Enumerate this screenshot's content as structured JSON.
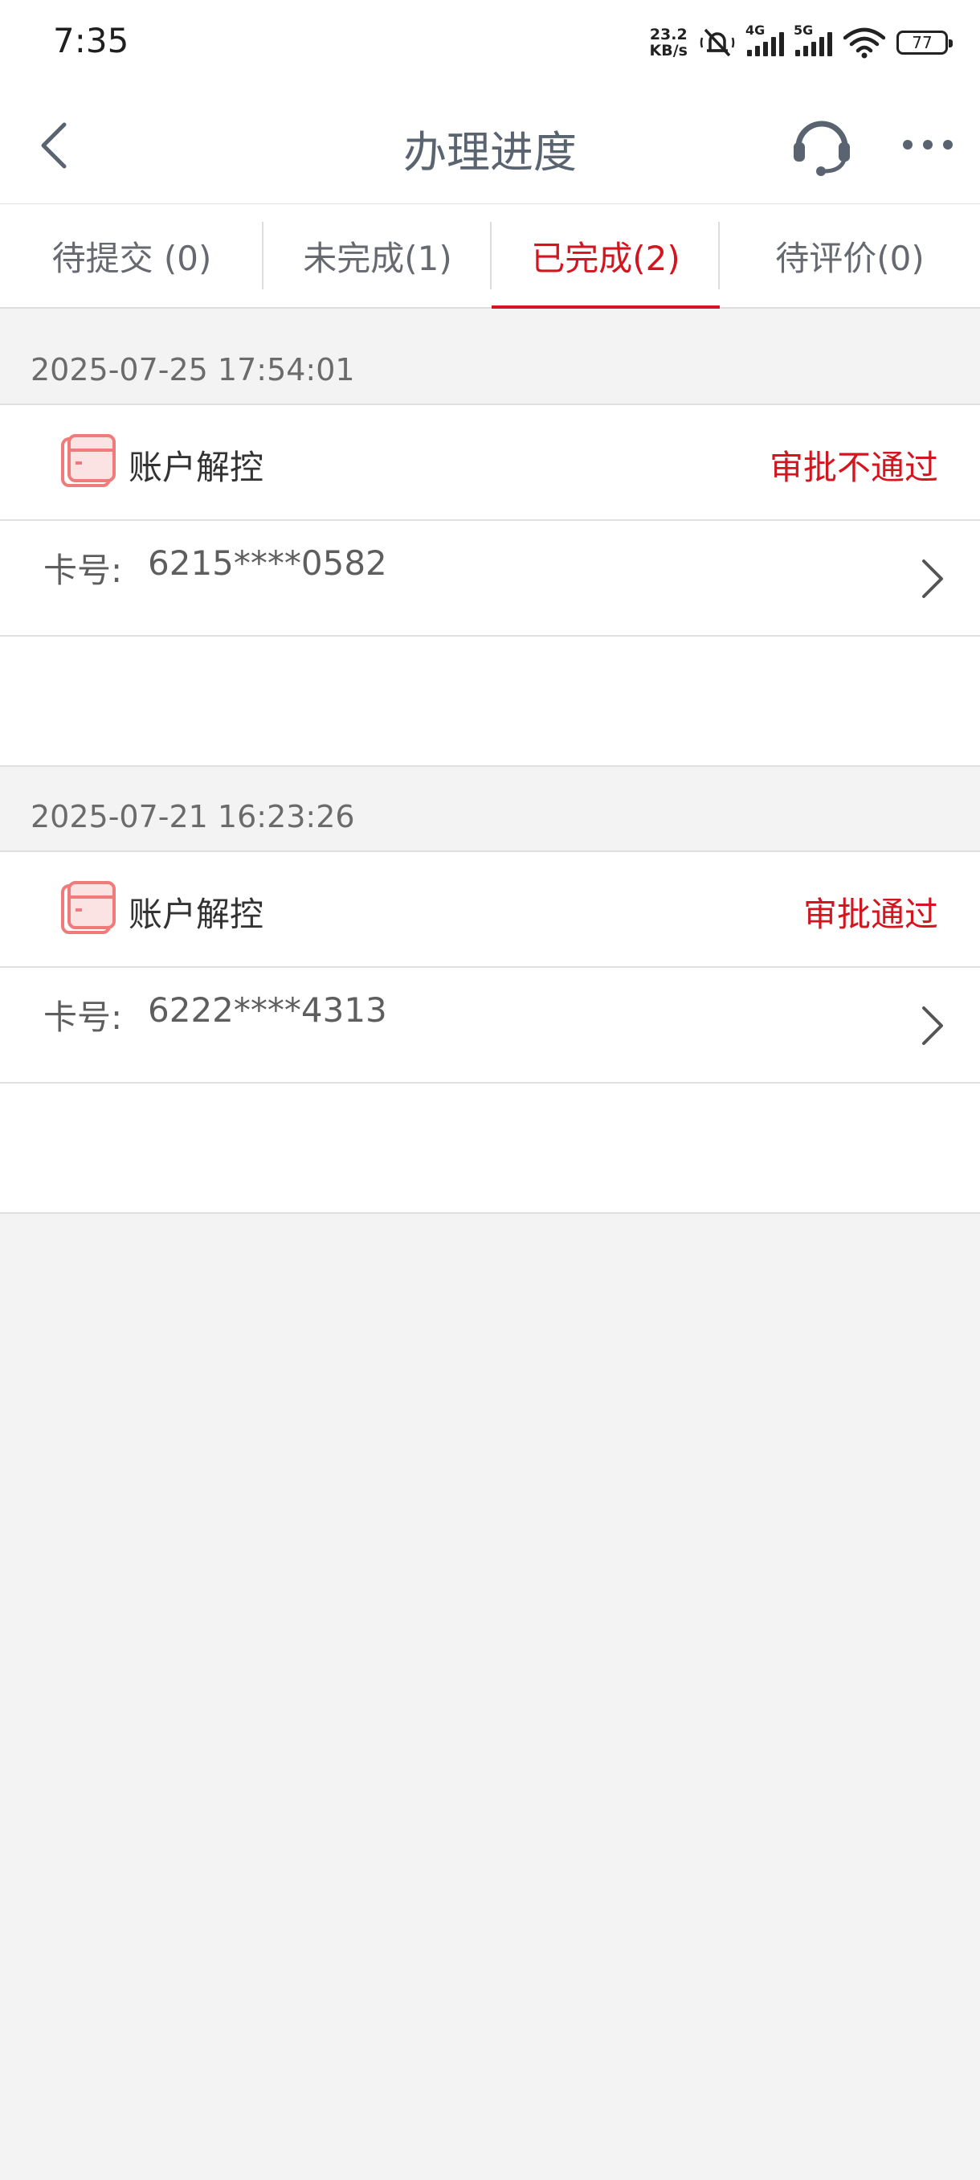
{
  "status_bar": {
    "time": "7:35",
    "net_speed_value": "23.2",
    "net_speed_unit": "KB/s",
    "sig1_label": "4G",
    "sig2_label": "5G",
    "battery": "77"
  },
  "nav": {
    "title": "办理进度",
    "back_icon": "chevron-left-icon",
    "support_icon": "headset-icon",
    "more_icon": "more-dots-icon"
  },
  "tabs": [
    {
      "label": "待提交 (0)",
      "active": false
    },
    {
      "label": "未完成(1)",
      "active": false
    },
    {
      "label": "已完成(2)",
      "active": true
    },
    {
      "label": "待评价(0)",
      "active": false
    }
  ],
  "records": [
    {
      "date": "2025-07-25 17:54:01",
      "service": "账户解控",
      "status": "审批不通过",
      "card_label": "卡号:",
      "card_number": "6215****0582"
    },
    {
      "date": "2025-07-21 16:23:26",
      "service": "账户解控",
      "status": "审批通过",
      "card_label": "卡号:",
      "card_number": "6222****4313"
    }
  ],
  "colors": {
    "accent": "#d2151e",
    "icon": "#f07b7b",
    "background": "#f3f3f3"
  }
}
